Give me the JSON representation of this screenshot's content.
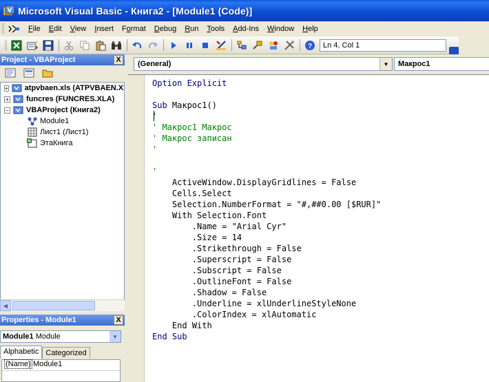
{
  "window": {
    "title": "Microsoft Visual Basic - Книга2 - [Module1 (Code)]"
  },
  "menu": {
    "items": [
      {
        "label": "File",
        "accel": "F",
        "rest": "ile"
      },
      {
        "label": "Edit",
        "accel": "E",
        "rest": "dit"
      },
      {
        "label": "View",
        "accel": "V",
        "rest": "iew"
      },
      {
        "label": "Insert",
        "accel": "I",
        "rest": "nsert"
      },
      {
        "label": "Format",
        "accel": "o",
        "pre": "F",
        "rest": "rmat"
      },
      {
        "label": "Debug",
        "accel": "D",
        "rest": "ebug"
      },
      {
        "label": "Run",
        "accel": "R",
        "rest": "un"
      },
      {
        "label": "Tools",
        "accel": "T",
        "rest": "ools"
      },
      {
        "label": "Add-Ins",
        "accel": "A",
        "rest": "dd-Ins"
      },
      {
        "label": "Window",
        "accel": "W",
        "rest": "indow"
      },
      {
        "label": "Help",
        "accel": "H",
        "rest": "elp"
      }
    ]
  },
  "toolbar": {
    "cursor_position": "Ln 4, Col 1"
  },
  "project": {
    "title": "Project - VBAProject",
    "close": "X",
    "tree": [
      {
        "label": "atpvbaen.xls (ATPVBAEN.XLA)",
        "level": 0,
        "expander": "+",
        "bold": true
      },
      {
        "label": "funcres (FUNCRES.XLA)",
        "level": 0,
        "expander": "+",
        "bold": true
      },
      {
        "label": "VBAProject (Книга2)",
        "level": 0,
        "expander": "−",
        "bold": true
      },
      {
        "label": "Module1",
        "level": 1,
        "bold": false
      },
      {
        "label": "Лист1 (Лист1)",
        "level": 1,
        "bold": false
      },
      {
        "label": "ЭтаКнига",
        "level": 1,
        "bold": false
      }
    ]
  },
  "properties": {
    "title": "Properties - Module1",
    "close": "X",
    "object_name": "Module1",
    "object_type": "Module",
    "tabs": [
      "Alphabetic",
      "Categorized"
    ],
    "rows": [
      {
        "name": "(Name)",
        "value": "Module1"
      }
    ]
  },
  "code": {
    "object_combo": "(General)",
    "proc_combo": "Макрос1",
    "lines": [
      {
        "text": "Option Explicit",
        "type": "kw"
      },
      {
        "text": "",
        "type": "plain"
      },
      {
        "text": "Sub Макрос1()",
        "type": "kwmix",
        "kw": "Sub",
        "rest": " Макрос1()"
      },
      {
        "text": "'",
        "type": "cm"
      },
      {
        "text": "' Макрос1 Макрос",
        "type": "cm"
      },
      {
        "text": "' Макрос записан",
        "type": "cm"
      },
      {
        "text": "'",
        "type": "cm"
      },
      {
        "text": "",
        "type": "plain"
      },
      {
        "text": "'",
        "type": "cm"
      },
      {
        "text": "    ActiveWindow.DisplayGridlines = False",
        "type": "plain"
      },
      {
        "text": "    Cells.Select",
        "type": "plain"
      },
      {
        "text": "    Selection.NumberFormat = \"#,##0.00 [$RUR]\"",
        "type": "plain"
      },
      {
        "text": "    With Selection.Font",
        "type": "plain"
      },
      {
        "text": "        .Name = \"Arial Cyr\"",
        "type": "plain"
      },
      {
        "text": "        .Size = 14",
        "type": "plain"
      },
      {
        "text": "        .Strikethrough = False",
        "type": "plain"
      },
      {
        "text": "        .Superscript = False",
        "type": "plain"
      },
      {
        "text": "        .Subscript = False",
        "type": "plain"
      },
      {
        "text": "        .OutlineFont = False",
        "type": "plain"
      },
      {
        "text": "        .Shadow = False",
        "type": "plain"
      },
      {
        "text": "        .Underline = xlUnderlineStyleNone",
        "type": "plain"
      },
      {
        "text": "        .ColorIndex = xlAutomatic",
        "type": "plain"
      },
      {
        "text": "    End With",
        "type": "plain"
      },
      {
        "text": "End Sub",
        "type": "kw"
      }
    ]
  },
  "colors": {
    "keyword": "#00007f",
    "comment": "#007f00",
    "titlebar": "#0a4fd6"
  }
}
